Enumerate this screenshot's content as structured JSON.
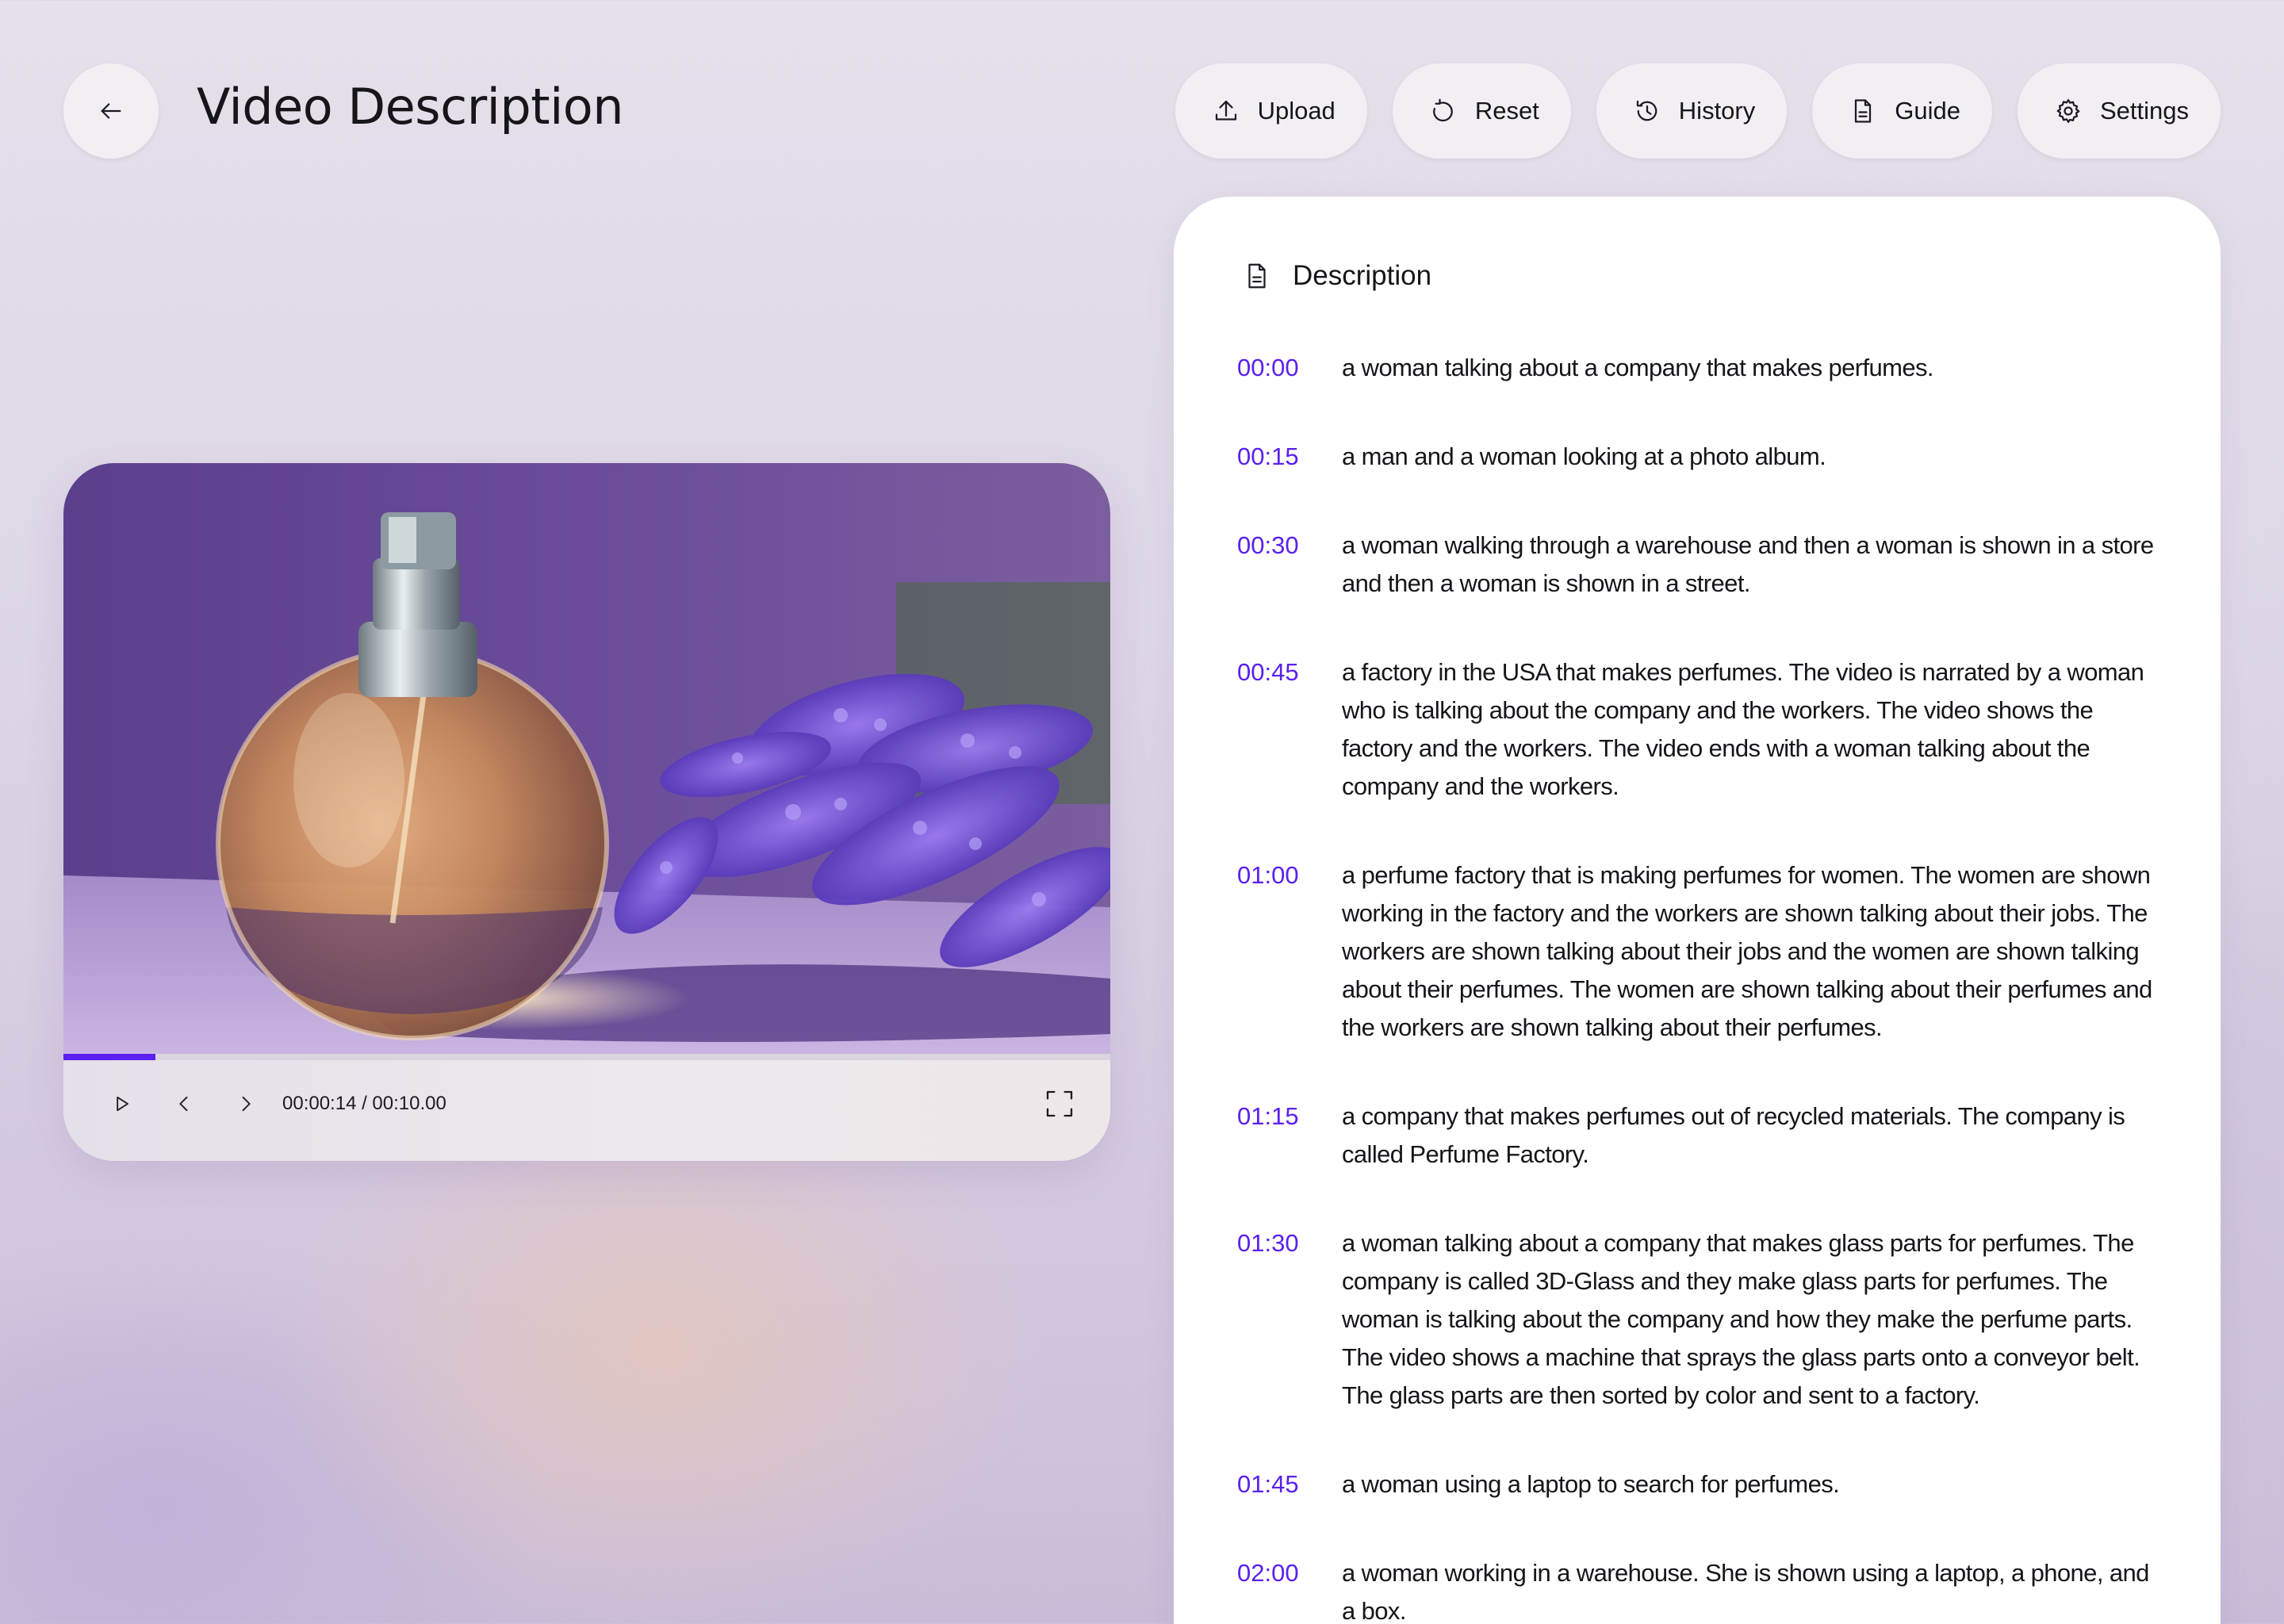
{
  "header": {
    "title": "Video Description",
    "back_icon": "arrow-left-icon"
  },
  "toolbar": {
    "buttons": [
      {
        "label": "Upload",
        "icon": "upload-icon"
      },
      {
        "label": "Reset",
        "icon": "reset-icon"
      },
      {
        "label": "History",
        "icon": "history-icon"
      },
      {
        "label": "Guide",
        "icon": "document-icon"
      },
      {
        "label": "Settings",
        "icon": "gear-icon"
      }
    ]
  },
  "player": {
    "timecode": "00:00:14 / 00:10.00",
    "progress_fraction": 0.088,
    "accent_color": "#5a20f0",
    "thumbnail": "perfume bottle with lavender flowers on purple background"
  },
  "description": {
    "title": "Description",
    "items": [
      {
        "time": "00:00",
        "text": "a woman talking about a company that makes perfumes."
      },
      {
        "time": "00:15",
        "text": "a man and a woman looking at a photo album."
      },
      {
        "time": "00:30",
        "text": "a woman walking through a warehouse and then a woman is shown in a store and then a woman is shown in a street."
      },
      {
        "time": "00:45",
        "text": "a factory in the USA that makes perfumes. The video is narrated by a woman who is talking about the company and the workers. The video shows the factory and the workers. The video ends with a woman talking about the company and the workers."
      },
      {
        "time": "01:00",
        "text": "a perfume factory that is making perfumes for women. The women are shown working in the factory and the workers are shown talking about their jobs. The workers are shown talking about their jobs and the women are shown talking about their perfumes. The women are shown talking about their perfumes and the workers are shown talking about their perfumes."
      },
      {
        "time": "01:15",
        "text": "a company that makes perfumes out of recycled materials. The company is called Perfume Factory."
      },
      {
        "time": "01:30",
        "text": "a woman talking about a company that makes glass parts for perfumes. The company is called 3D-Glass and they make glass parts for perfumes. The woman is talking about the company and how they make the perfume parts. The video shows a machine that sprays the glass parts onto a conveyor belt. The glass parts are then sorted by color and sent to a factory."
      },
      {
        "time": "01:45",
        "text": "a woman using a laptop to search for perfumes."
      },
      {
        "time": "02:00",
        "text": "a woman working in a warehouse. She is shown using a laptop, a phone, and a box."
      }
    ]
  }
}
